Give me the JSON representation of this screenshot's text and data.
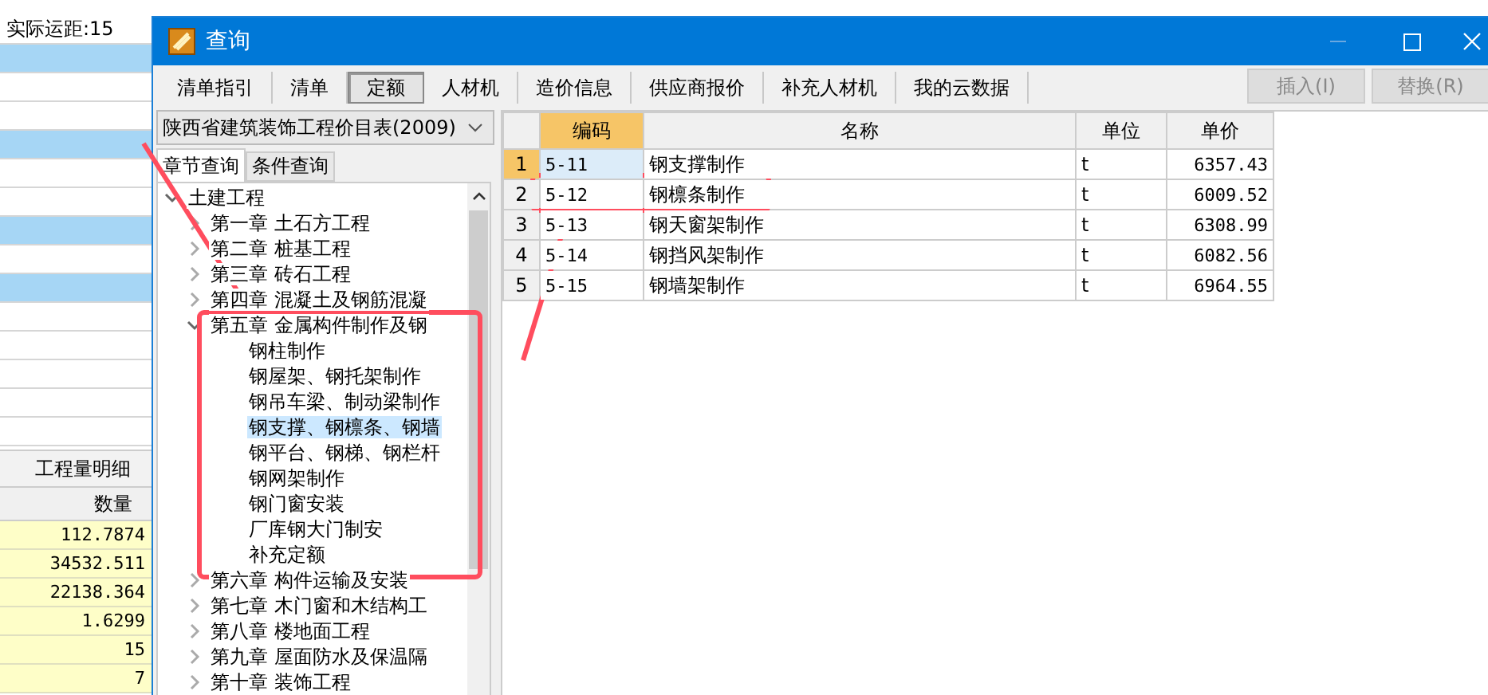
{
  "background_app": {
    "rows": [
      {
        "text": "实际运距:15",
        "highlight": false
      },
      {
        "text": "",
        "highlight": true
      },
      {
        "text": "",
        "highlight": false
      },
      {
        "text": "",
        "highlight": false
      },
      {
        "text": "",
        "highlight": true
      },
      {
        "text": "",
        "highlight": false
      },
      {
        "text": "",
        "highlight": false
      },
      {
        "text": "",
        "highlight": true
      },
      {
        "text": "",
        "highlight": false
      },
      {
        "text": "",
        "highlight": true
      },
      {
        "text": "",
        "highlight": false
      },
      {
        "text": "",
        "highlight": false
      },
      {
        "text": "",
        "highlight": false
      },
      {
        "text": "",
        "highlight": false
      },
      {
        "text": "",
        "highlight": false
      }
    ],
    "tab": "工程量明细",
    "quantity_header": "数量",
    "quantities": [
      "112.7874",
      "34532.511",
      "22138.364",
      "1.6299",
      "15",
      "7"
    ]
  },
  "dialog": {
    "title": "查询",
    "tabs": [
      {
        "label": "清单指引",
        "selected": false
      },
      {
        "label": "清单",
        "selected": false
      },
      {
        "label": "定额",
        "selected": true
      },
      {
        "label": "人材机",
        "selected": false
      },
      {
        "label": "造价信息",
        "selected": false
      },
      {
        "label": "供应商报价",
        "selected": false
      },
      {
        "label": "补充人材机",
        "selected": false
      },
      {
        "label": "我的云数据",
        "selected": false
      }
    ],
    "buttons": [
      {
        "label": "插入(I)",
        "disabled": true
      },
      {
        "label": "替换(R)",
        "disabled": true
      }
    ],
    "library": "陕西省建筑装饰工程价目表(2009)",
    "query_tabs": [
      {
        "label": "章节查询",
        "selected": true
      },
      {
        "label": "条件查询",
        "selected": false
      }
    ],
    "tree": [
      {
        "label": "土建工程",
        "expanded": true,
        "selected": false,
        "children": [
          {
            "label": "第一章  土石方工程",
            "expanded": false,
            "selected": false
          },
          {
            "label": "第二章  桩基工程",
            "expanded": false,
            "selected": false
          },
          {
            "label": "第三章  砖石工程",
            "expanded": false,
            "selected": false
          },
          {
            "label": "第四章  混凝土及钢筋混凝",
            "expanded": false,
            "selected": false
          },
          {
            "label": "第五章  金属构件制作及钢",
            "expanded": true,
            "selected": false,
            "children": [
              {
                "label": "钢柱制作",
                "selected": false
              },
              {
                "label": "钢屋架、钢托架制作",
                "selected": false
              },
              {
                "label": "钢吊车梁、制动梁制作",
                "selected": false
              },
              {
                "label": "钢支撑、钢檩条、钢墙",
                "selected": true
              },
              {
                "label": "钢平台、钢梯、钢栏杆",
                "selected": false
              },
              {
                "label": "钢网架制作",
                "selected": false
              },
              {
                "label": "钢门窗安装",
                "selected": false
              },
              {
                "label": "厂库钢大门制安",
                "selected": false
              },
              {
                "label": "补充定额",
                "selected": false
              }
            ]
          },
          {
            "label": "第六章  构件运输及安装",
            "expanded": false,
            "selected": false
          },
          {
            "label": "第七章  木门窗和木结构工",
            "expanded": false,
            "selected": false
          },
          {
            "label": "第八章  楼地面工程",
            "expanded": false,
            "selected": false
          },
          {
            "label": "第九章  屋面防水及保温隔",
            "expanded": false,
            "selected": false
          },
          {
            "label": "第十章  装饰工程",
            "expanded": false,
            "selected": false
          }
        ]
      }
    ],
    "table": {
      "columns": [
        "编码",
        "名称",
        "单位",
        "单价"
      ],
      "rows": [
        {
          "index": "1",
          "code": "5-11",
          "name": "钢支撑制作",
          "unit": "t",
          "price": "6357.43",
          "selected": true
        },
        {
          "index": "2",
          "code": "5-12",
          "name": "钢檩条制作",
          "unit": "t",
          "price": "6009.52",
          "selected": false
        },
        {
          "index": "3",
          "code": "5-13",
          "name": "钢天窗架制作",
          "unit": "t",
          "price": "6308.99",
          "selected": false
        },
        {
          "index": "4",
          "code": "5-14",
          "name": "钢挡风架制作",
          "unit": "t",
          "price": "6082.56",
          "selected": false
        },
        {
          "index": "5",
          "code": "5-15",
          "name": "钢墙架制作",
          "unit": "t",
          "price": "6964.55",
          "selected": false
        }
      ]
    }
  }
}
